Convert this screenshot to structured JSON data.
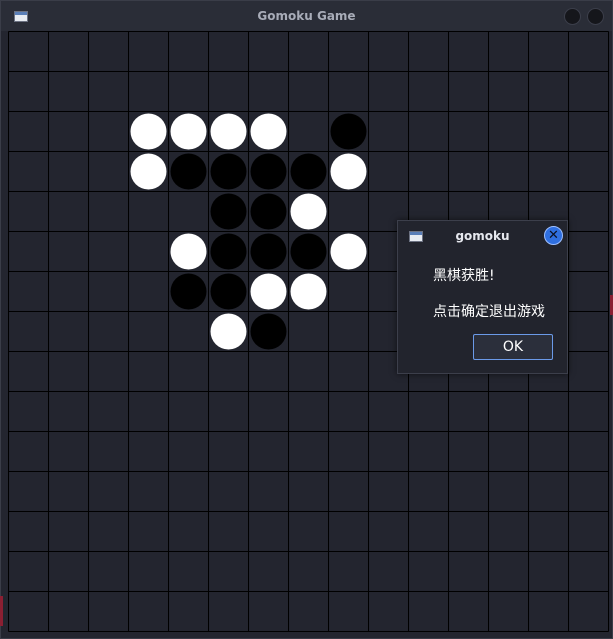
{
  "window": {
    "title": "Gomoku Game",
    "app_icon": "window-icon",
    "controls": [
      "minimize-button",
      "close-button"
    ]
  },
  "board": {
    "size": 15,
    "line_color": "#000000",
    "background": "#23252f",
    "stones": [
      {
        "col": 3,
        "row": 2,
        "color": "white"
      },
      {
        "col": 4,
        "row": 2,
        "color": "white"
      },
      {
        "col": 5,
        "row": 2,
        "color": "white"
      },
      {
        "col": 6,
        "row": 2,
        "color": "white"
      },
      {
        "col": 8,
        "row": 2,
        "color": "black"
      },
      {
        "col": 3,
        "row": 3,
        "color": "white"
      },
      {
        "col": 4,
        "row": 3,
        "color": "black"
      },
      {
        "col": 5,
        "row": 3,
        "color": "black"
      },
      {
        "col": 6,
        "row": 3,
        "color": "black"
      },
      {
        "col": 7,
        "row": 3,
        "color": "black"
      },
      {
        "col": 8,
        "row": 3,
        "color": "white"
      },
      {
        "col": 5,
        "row": 4,
        "color": "black"
      },
      {
        "col": 6,
        "row": 4,
        "color": "black"
      },
      {
        "col": 7,
        "row": 4,
        "color": "white"
      },
      {
        "col": 4,
        "row": 5,
        "color": "white"
      },
      {
        "col": 5,
        "row": 5,
        "color": "black"
      },
      {
        "col": 6,
        "row": 5,
        "color": "black"
      },
      {
        "col": 7,
        "row": 5,
        "color": "black"
      },
      {
        "col": 8,
        "row": 5,
        "color": "white"
      },
      {
        "col": 4,
        "row": 6,
        "color": "black"
      },
      {
        "col": 5,
        "row": 6,
        "color": "black"
      },
      {
        "col": 6,
        "row": 6,
        "color": "white"
      },
      {
        "col": 7,
        "row": 6,
        "color": "white"
      },
      {
        "col": 5,
        "row": 7,
        "color": "white"
      },
      {
        "col": 6,
        "row": 7,
        "color": "black"
      }
    ]
  },
  "dialog": {
    "title": "gomoku",
    "icon": "window-icon",
    "close_icon": "close-icon",
    "message_1": "黑棋获胜!",
    "message_2": "点击确定退出游戏",
    "ok_label": "OK"
  },
  "colors": {
    "accent": "#2f6fe0",
    "button_border": "#6b9ae8"
  }
}
